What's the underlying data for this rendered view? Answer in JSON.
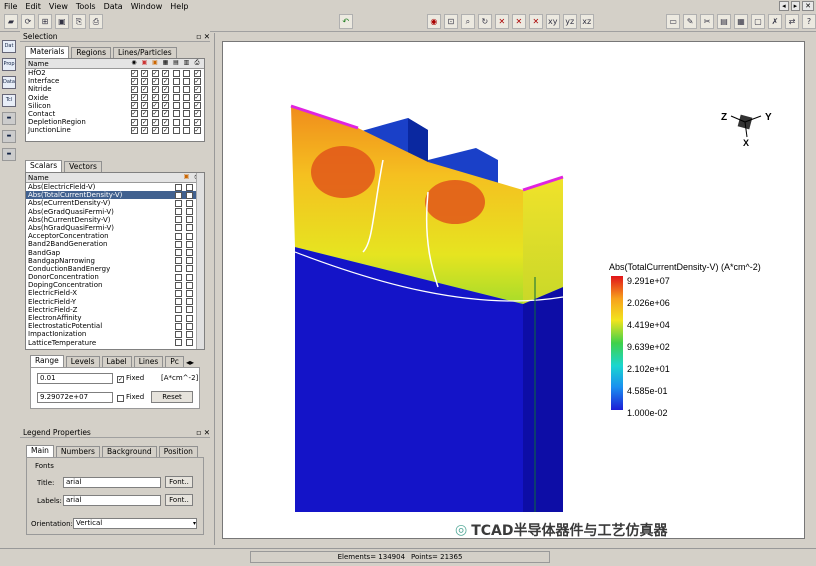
{
  "menu": {
    "items": [
      "File",
      "Edit",
      "View",
      "Tools",
      "Data",
      "Window",
      "Help"
    ],
    "window_buttons": [
      "◂",
      "▸",
      "✕"
    ]
  },
  "toolbar": {
    "left_icons": [
      "open-icon",
      "reload-icon",
      "tree-icon",
      "snapshot-icon",
      "export-icon",
      "print-icon",
      "undo-icon"
    ],
    "right_icons": [
      "eye-icon",
      "zoom-fit-icon",
      "zoom-icon",
      "rotate-icon",
      "axis-x-icon",
      "axis-y-icon",
      "axis-z-icon",
      "xy-icon",
      "yz-icon",
      "xz-icon",
      "ruler-icon",
      "probe-icon",
      "cut-icon",
      "chart-icon",
      "tile-icon",
      "lock-icon",
      "close-view-icon",
      "sync-icon",
      "help-icon"
    ]
  },
  "left_tools": [
    "Dat",
    "Prop",
    "Data",
    "Tcl"
  ],
  "selection": {
    "title": "Selection",
    "tabs": [
      "Materials",
      "Regions",
      "Lines/Particles"
    ],
    "header": "Name",
    "materials": [
      "HfO2",
      "Interface",
      "Nitride",
      "Oxide",
      "Silicon",
      "Contact",
      "DepletionRegion",
      "JunctionLine"
    ],
    "scalar_tabs": [
      "Scalars",
      "Vectors"
    ],
    "scalars": [
      "Abs(ElectricField-V)",
      "Abs(TotalCurrentDensity-V)",
      "Abs(eCurrentDensity-V)",
      "Abs(eGradQuasiFermi-V)",
      "Abs(hCurrentDensity-V)",
      "Abs(hGradQuasiFermi-V)",
      "AcceptorConcentration",
      "Band2BandGeneration",
      "BandGap",
      "BandgapNarrowing",
      "ConductionBandEnergy",
      "DonorConcentration",
      "DopingConcentration",
      "ElectricField-X",
      "ElectricField-Y",
      "ElectricField-Z",
      "ElectronAffinity",
      "ElectrostaticPotential",
      "ImpactIonization",
      "LatticeTemperature"
    ],
    "selected_scalar": "Abs(TotalCurrentDensity-V)",
    "range_tabs": [
      "Range",
      "Levels",
      "Label",
      "Lines",
      "Pc"
    ],
    "min_value": "0.01",
    "max_value": "9.29072e+07",
    "fixed_label": "Fixed",
    "unit": "[A*cm^-2]",
    "reset": "Reset"
  },
  "legend_props": {
    "title": "Legend Properties",
    "tabs": [
      "Main",
      "Numbers",
      "Background",
      "Position"
    ],
    "fonts_label": "Fonts",
    "title_label": "Title:",
    "title_font": "arial",
    "labels_label": "Labels:",
    "labels_font": "arial",
    "font_button": "Font..",
    "orientation_label": "Orientation:",
    "orientation_value": "Vertical"
  },
  "legend": {
    "title": "Abs(TotalCurrentDensity-V) (A*cm^-2)",
    "values": [
      "9.291e+07",
      "2.026e+06",
      "4.419e+04",
      "9.639e+02",
      "2.102e+01",
      "4.585e-01",
      "1.000e-02"
    ],
    "colors": [
      "#e0141a",
      "#f7a21d",
      "#f2e41e",
      "#3fd14a",
      "#1ad6d0",
      "#1a8ff0",
      "#1c1ed6"
    ]
  },
  "axes": {
    "z": "Z",
    "y": "Y",
    "x": "X"
  },
  "status": {
    "elements": "Elements= 134904",
    "points": "Points= 21365"
  },
  "watermark": "TCAD半导体器件与工艺仿真器"
}
